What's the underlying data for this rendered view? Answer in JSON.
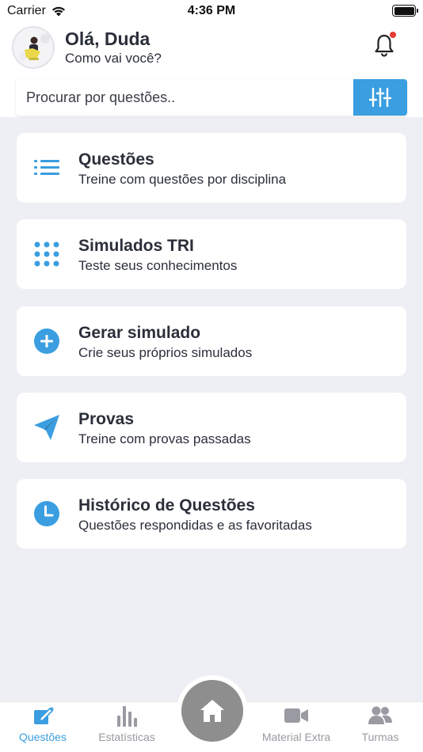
{
  "status_bar": {
    "carrier": "Carrier",
    "time": "4:36 PM"
  },
  "header": {
    "greeting": "Olá, Duda",
    "subtitle": "Como vai você?",
    "notification_dot_color": "#e53935"
  },
  "search": {
    "placeholder": "Procurar por questões..",
    "value": ""
  },
  "menu": [
    {
      "title": "Questões",
      "description": "Treine com questões por disciplina",
      "icon": "list-icon"
    },
    {
      "title": "Simulados TRI",
      "description": "Teste seus conhecimentos",
      "icon": "grid-dots-icon"
    },
    {
      "title": "Gerar simulado",
      "description": "Crie seus próprios simulados",
      "icon": "plus-circle-icon"
    },
    {
      "title": "Provas",
      "description": "Treine com provas passadas",
      "icon": "paper-plane-icon"
    },
    {
      "title": "Histórico de Questões",
      "description": "Questões respondidas e as favoritadas",
      "icon": "clock-icon"
    }
  ],
  "tabbar": {
    "tabs": [
      {
        "label": "Questões",
        "icon": "edit-icon",
        "active": true
      },
      {
        "label": "Estatísticas",
        "icon": "bar-chart-icon",
        "active": false
      },
      {
        "label": "",
        "icon": "home-icon",
        "active": false
      },
      {
        "label": "Material Extra",
        "icon": "video-camera-icon",
        "active": false
      },
      {
        "label": "Turmas",
        "icon": "group-icon",
        "active": false
      }
    ]
  },
  "colors": {
    "accent": "#3a9ee0",
    "background": "#eeeff4",
    "text": "#2b2f3a",
    "inactive": "#9a9aa2",
    "home_button": "#8e8e8e"
  }
}
